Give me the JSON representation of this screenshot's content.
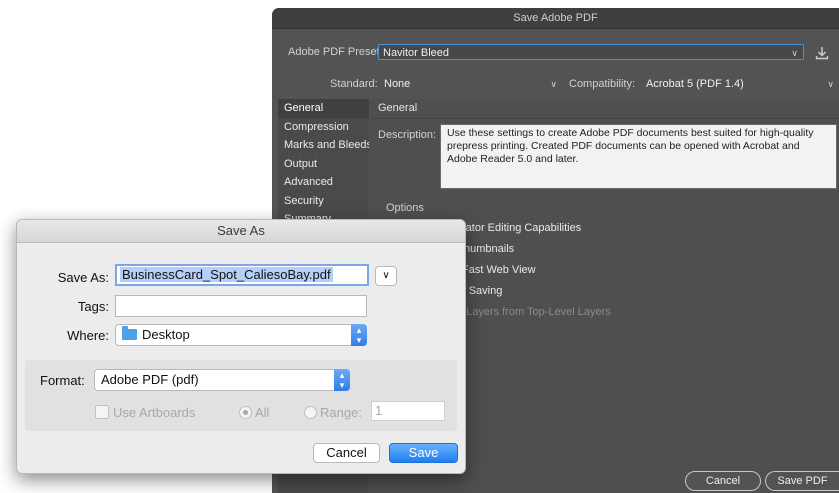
{
  "pdf_dialog": {
    "title": "Save Adobe PDF",
    "preset_label": "Adobe PDF Preset:",
    "preset_value": "Navitor Bleed",
    "standard_label": "Standard:",
    "standard_value": "None",
    "compat_label": "Compatibility:",
    "compat_value": "Acrobat 5 (PDF 1.4)",
    "sidebar": [
      "General",
      "Compression",
      "Marks and Bleeds",
      "Output",
      "Advanced",
      "Security",
      "Summary"
    ],
    "section_title": "General",
    "description_label": "Description:",
    "description_text": "Use these settings to create Adobe PDF documents best suited for high-quality prepress printing.  Created PDF documents can be opened with Acrobat and Adobe Reader 5.0 and later.",
    "options_title": "Options",
    "options": [
      "rator Editing Capabilities",
      "humbnails",
      "Fast Web View",
      "r Saving",
      "t Layers from Top-Level Layers"
    ],
    "cancel_label": "Cancel",
    "save_label": "Save PDF"
  },
  "save_as": {
    "title": "Save As",
    "save_as_label": "Save As:",
    "filename": "BusinessCard_Spot_CaliesoBay.pdf",
    "tags_label": "Tags:",
    "tags_value": "",
    "where_label": "Where:",
    "where_value": "Desktop",
    "format_label": "Format:",
    "format_value": "Adobe PDF (pdf)",
    "use_artboards_label": "Use Artboards",
    "all_label": "All",
    "range_label": "Range:",
    "range_value": "1",
    "cancel_label": "Cancel",
    "save_label": "Save"
  },
  "colors": {
    "accent": "#2f7de9",
    "dark_panel": "#535353",
    "light_panel": "#ececec"
  }
}
